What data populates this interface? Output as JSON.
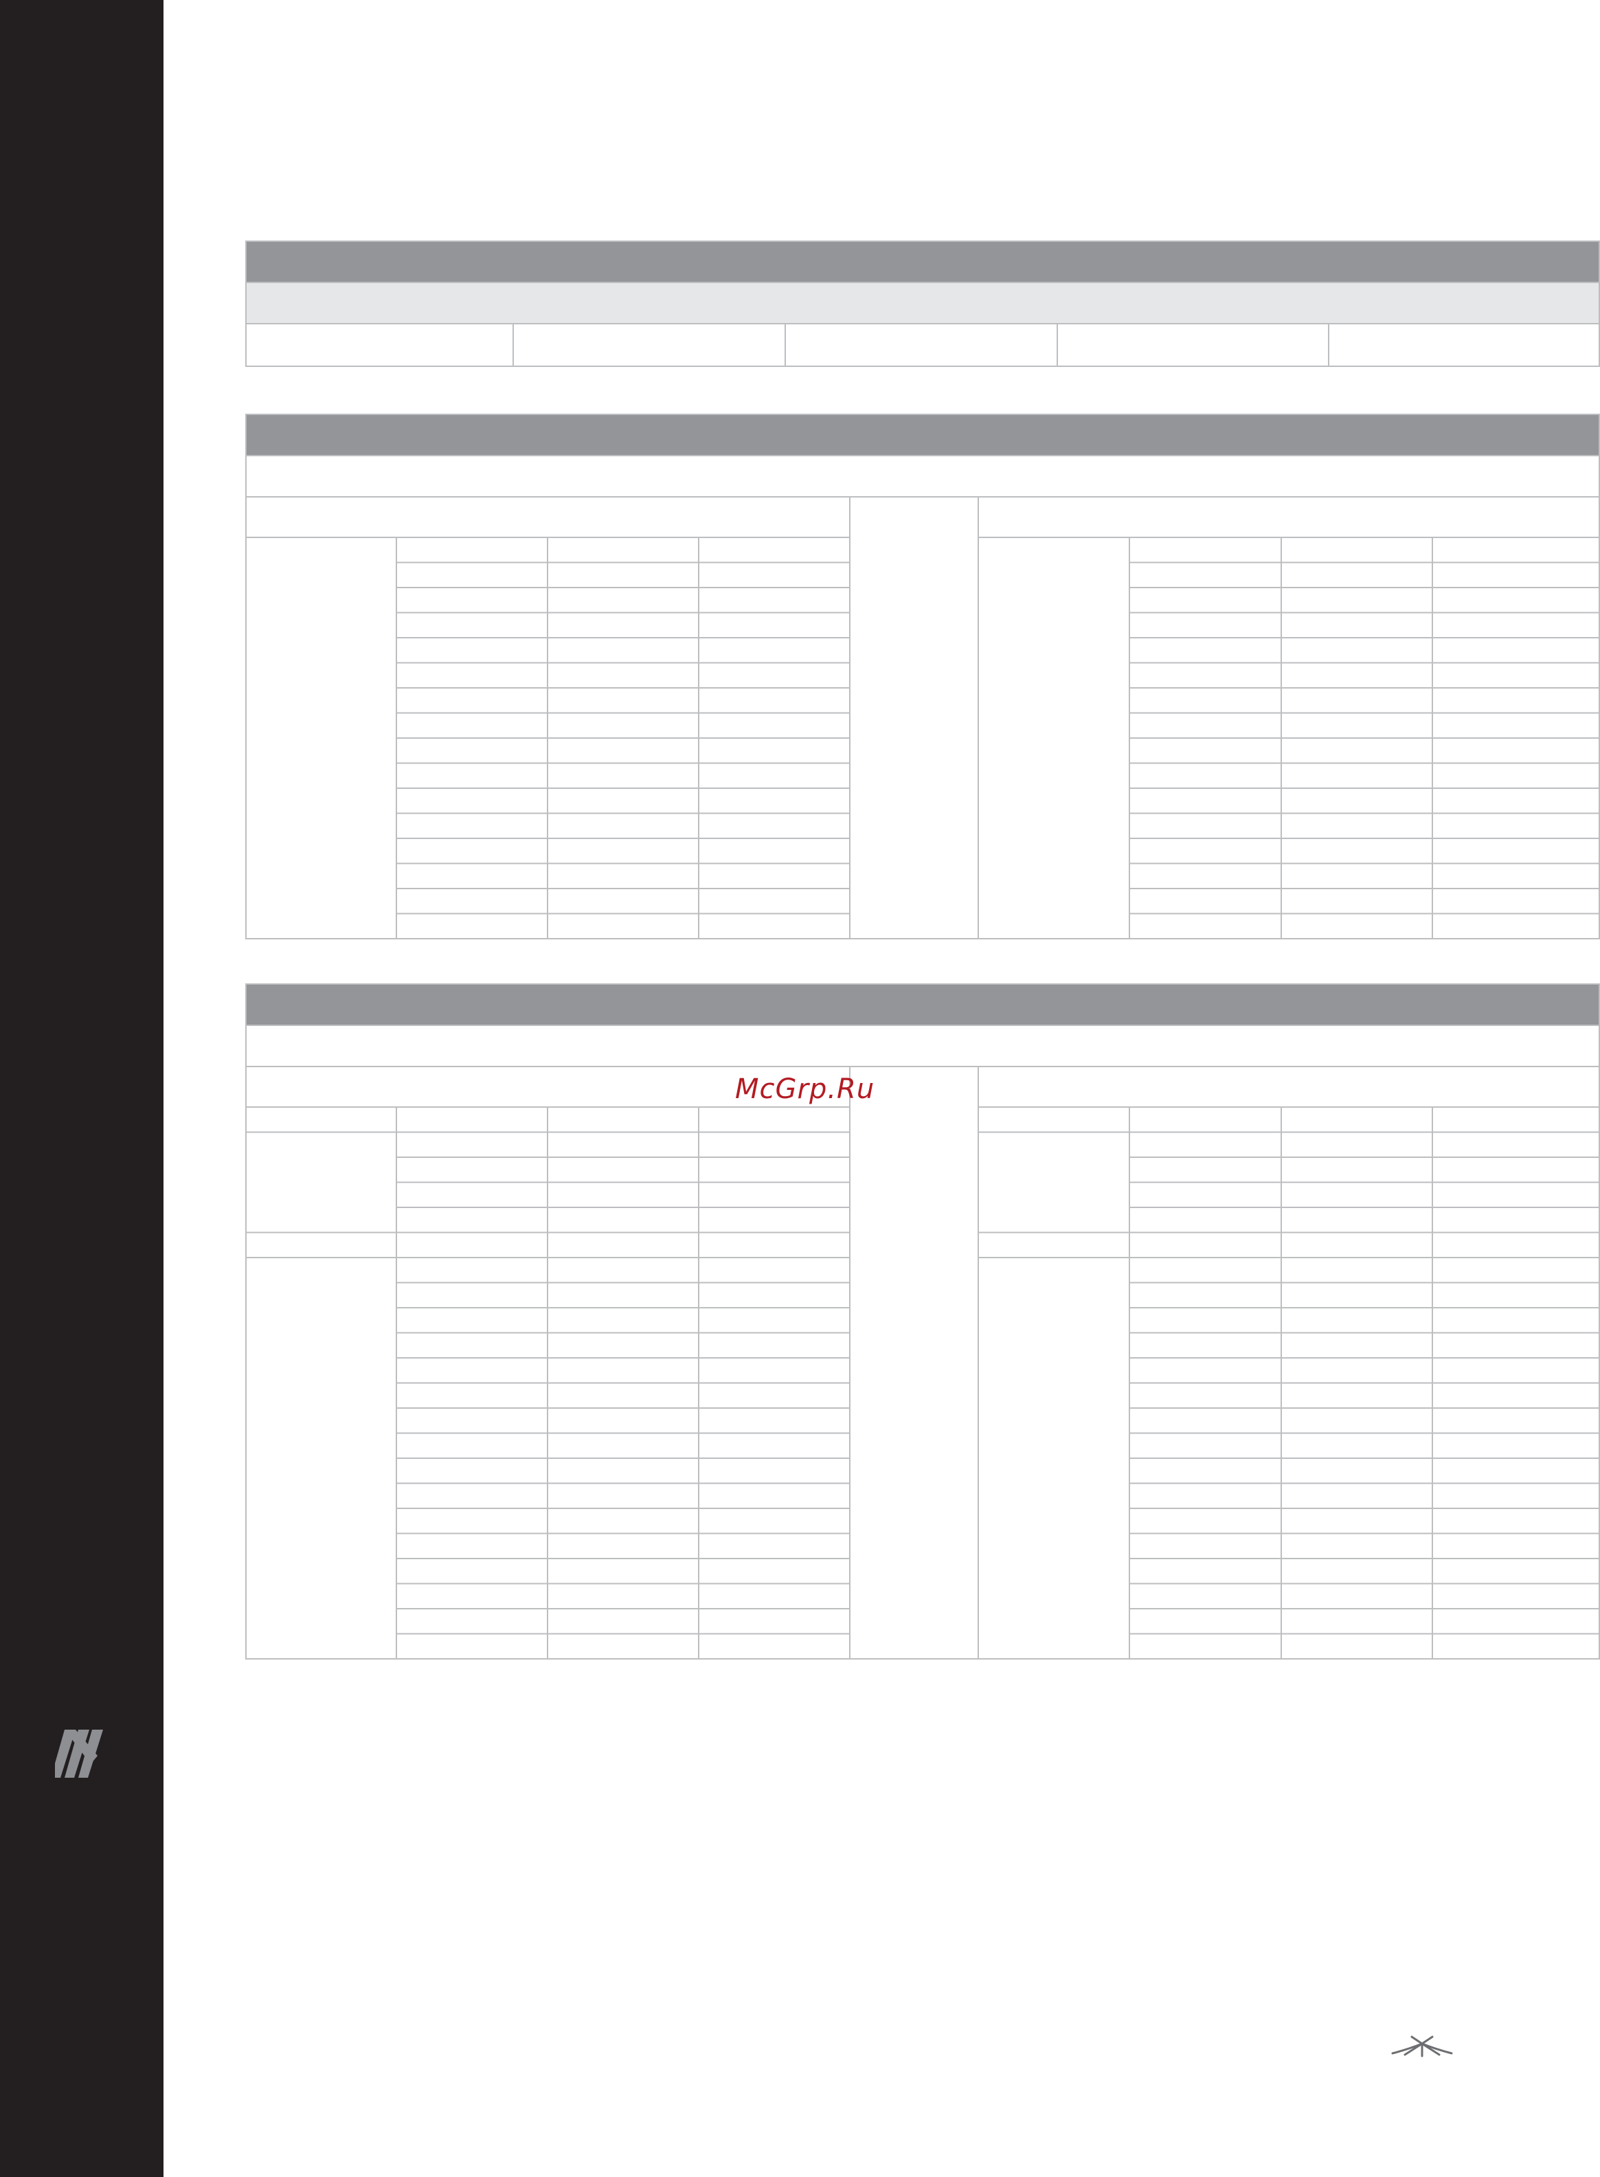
{
  "watermark": {
    "text": "McGrp.Ru"
  },
  "sidebar": {
    "logo_icon": "m-letter-logo-icon",
    "background": "#231f20"
  },
  "footer": {
    "brand_icon": "ubiquiti-logo-icon"
  },
  "colors": {
    "header_dark": "#939598",
    "header_light": "#e6e7e8",
    "rule": "#bcbec0"
  }
}
